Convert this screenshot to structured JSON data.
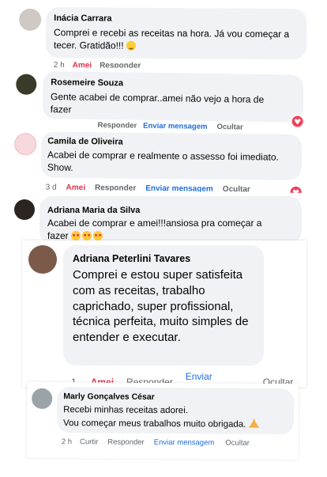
{
  "comments": [
    {
      "name": "Inácia Carrara",
      "text": "Comprei e recebi as receitas na hora. Já vou começar a tecer. Gratidão!!!",
      "time": "2 h",
      "like": "Amei",
      "reply": "Responder"
    },
    {
      "name": "Rosemeire Souza",
      "text": "Gente acabei de comprar..amei não vejo a hora de fazer",
      "reply": "Responder",
      "message": "Enviar mensagem",
      "hide": "Ocultar"
    },
    {
      "name": "Camila de Oliveira",
      "text": "Acabei de comprar e realmente o assesso foi imediato. Show.",
      "time": "3 d",
      "like": "Amei",
      "reply": "Responder",
      "message": "Enviar mensagem",
      "hide": "Ocultar"
    },
    {
      "name": "Adriana Maria da Silva",
      "text": "Acabei de comprar e amei!!!ansiosa pra começar a fazer"
    },
    {
      "name": "Adriana Peterlini Tavares",
      "text": "Comprei e estou super satisfeita com as receitas, trabalho caprichado, super profissional, técnica perfeita, muito simples de entender e executar.",
      "time": "1",
      "like": "Amei",
      "reply": "Responder",
      "message": "Enviar mensagem",
      "hide": "Ocultar"
    },
    {
      "name": "Marly Gonçalves César",
      "text1": "Recebi minhas receitas adorei.",
      "text2": "Vou começar meus trabalhos muito obrigada.",
      "time": "2 h",
      "like": "Curtir",
      "reply": "Responder",
      "message": "Enviar mensagem",
      "hide": "Ocultar"
    }
  ],
  "icons": {
    "reaction": "love-reaction-icon",
    "emoji": [
      "smiling-face-icon",
      "heart-eyes-icon",
      "praying-hands-icon"
    ]
  }
}
